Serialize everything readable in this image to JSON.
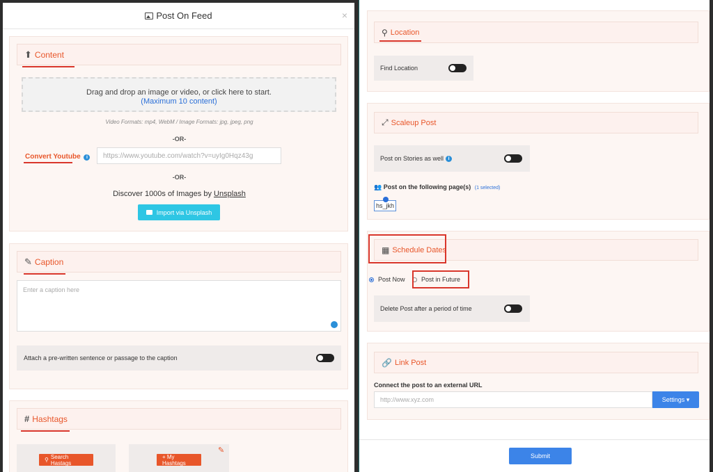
{
  "modal": {
    "title": "Post On Feed",
    "close": "×"
  },
  "content": {
    "heading": "Content",
    "drop_text": "Drag and drop an image or video, or click here to start.",
    "max_text": "(Maximum 10 content)",
    "formats": "Video Formats: mp4, WebM / Image Formats: jpg, jpeg, png",
    "or1": "-OR-",
    "youtube_label": "Convert Youtube",
    "youtube_info": "i",
    "youtube_placeholder": "https://www.youtube.com/watch?v=uyIg0Hqz43g",
    "or2": "-OR-",
    "discover_prefix": "Discover 1000s of Images by ",
    "discover_link": "Unsplash",
    "import_button": "Import via Unsplash"
  },
  "caption": {
    "heading": "Caption",
    "placeholder": "Enter a caption here",
    "attach_label": "Attach a pre-written sentence or passage to the caption"
  },
  "hashtags": {
    "heading": "Hashtags",
    "search_button": "Search Hastags",
    "my_button": "+ My Hashtags"
  },
  "location": {
    "heading": "Location",
    "find_label": "Find Location"
  },
  "scaleup": {
    "heading": "Scaleup Post",
    "stories_label": "Post on Stories as well",
    "stories_info": "i",
    "pages_label": "Post on the following page(s)",
    "pages_selected": "(1 selected)",
    "page_chip": "hs_jkh"
  },
  "schedule": {
    "heading": "Schedule Dates",
    "post_now": "Post Now",
    "post_future": "Post in Future",
    "delete_label": "Delete Post after a period of time"
  },
  "link": {
    "heading": "Link Post",
    "connect_label": "Connect the post to an external URL",
    "url_placeholder": "http://www.xyz.com",
    "settings_button": "Settings ▾"
  },
  "submit_button": "Submit",
  "colors": {
    "accent": "#e8562a",
    "primary": "#3c84e8",
    "unsplash": "#2ec6e4",
    "highlight": "#d9362b"
  }
}
